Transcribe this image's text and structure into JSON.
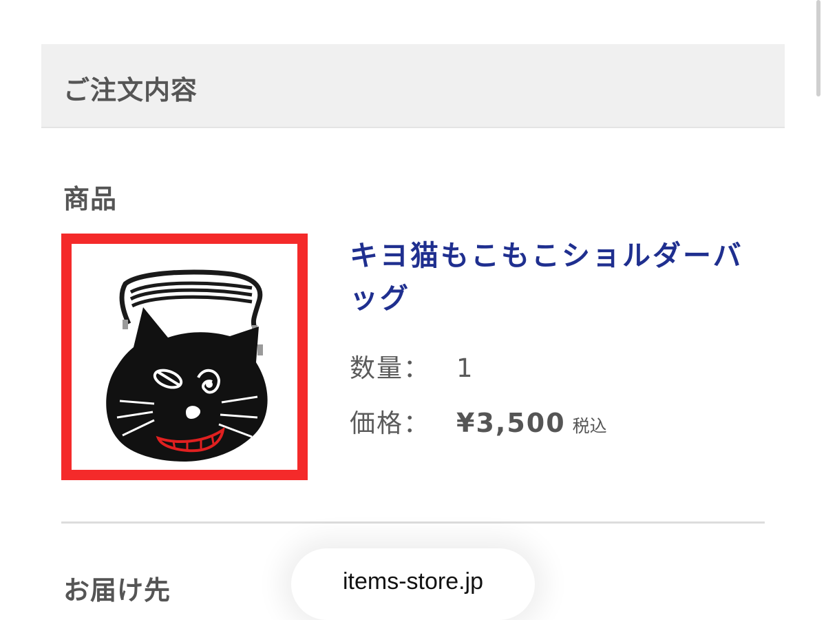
{
  "order": {
    "section_title": "ご注文内容"
  },
  "product": {
    "section_label": "商品",
    "image_icon": "black-cat-face-shoulder-bag",
    "name": "キヨ猫もこもこショルダーバッグ",
    "quantity_label": "数量：",
    "quantity": "1",
    "price_label": "価格：",
    "price": "¥3,500",
    "tax_note": "税込",
    "highlight_color": "#f42a2a",
    "name_color": "#1f2f8f"
  },
  "delivery": {
    "section_label": "お届け先"
  },
  "browser": {
    "url": "items-store.jp"
  }
}
